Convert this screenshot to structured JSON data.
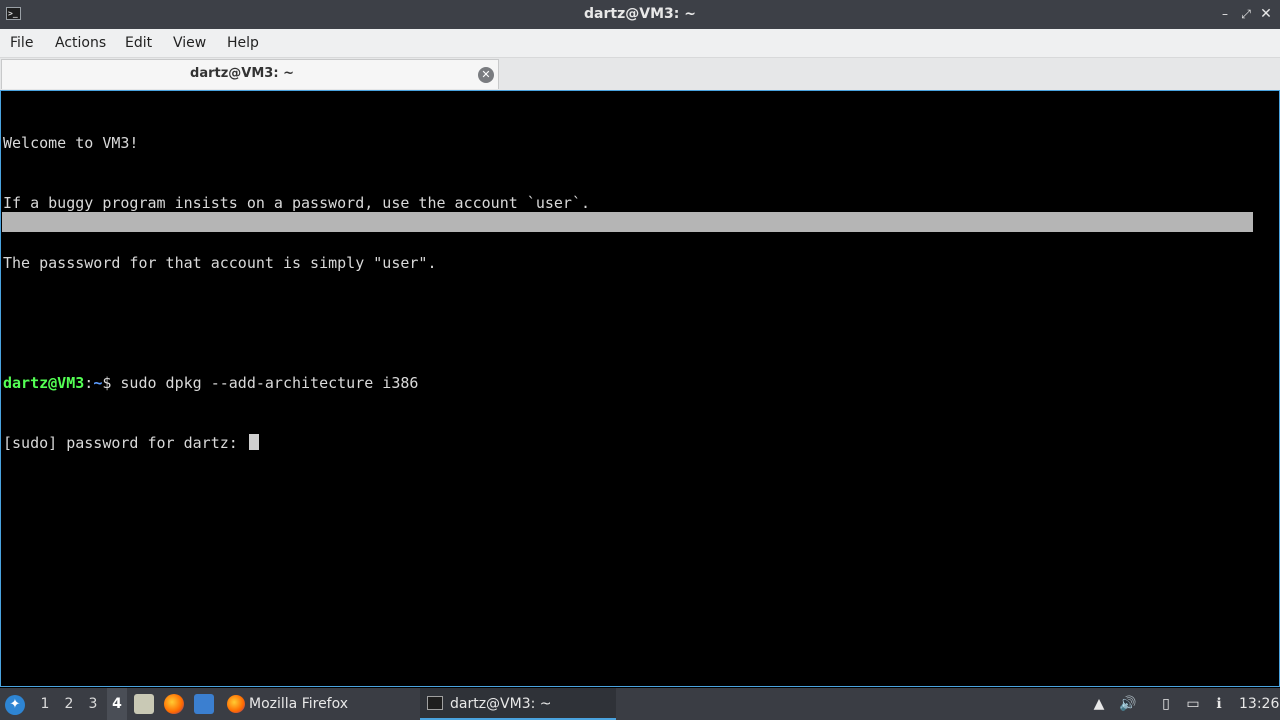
{
  "window": {
    "title": "dartz@VM3: ~",
    "controls": {
      "minimize": "–",
      "maximize": "⤢",
      "close": "✕"
    }
  },
  "menu": [
    "File",
    "Actions",
    "Edit",
    "View",
    "Help"
  ],
  "tab": {
    "title": "dartz@VM3: ~",
    "close_icon": "✕"
  },
  "terminal": {
    "motd": [
      "Welcome to VM3!",
      "If a buggy program insists on a password, use the account `user`.",
      "The passsword for that account is simply \"user\"."
    ],
    "prompt_user": "dartz@VM3",
    "prompt_sep": ":",
    "prompt_path": "~",
    "prompt_symbol": "$ ",
    "command": "sudo dpkg --add-architecture i386",
    "sudo_prompt": "[sudo] password for dartz: "
  },
  "taskbar": {
    "workspaces": [
      "1",
      "2",
      "3",
      "4"
    ],
    "active_workspace": "4",
    "tasks": [
      {
        "label": "Mozilla Firefox",
        "icon": "firefox-icon"
      },
      {
        "label": "dartz@VM3: ~",
        "icon": "terminal-icon",
        "active": true
      }
    ],
    "tray": [
      "update-icon",
      "volume-icon",
      "clipboard-icon",
      "network-icon",
      "info-icon"
    ],
    "clock": "13:26"
  },
  "colors": {
    "prompt_user": "#54ff54",
    "prompt_path": "#5c9cff",
    "accent": "#4aa3df"
  }
}
